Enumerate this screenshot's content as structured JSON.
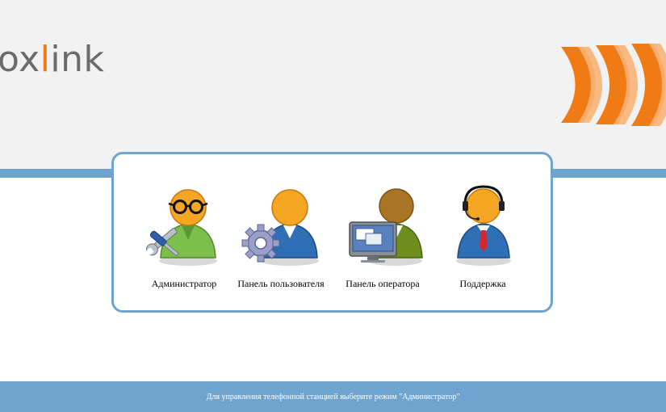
{
  "header": {
    "logo": {
      "text_start": "ox",
      "text_accent": "l",
      "text_end": "ink",
      "text_color": "#6b6b6b",
      "accent_color": "#f07a14"
    },
    "brand_icon": "orange-waves-logo-icon"
  },
  "modes": [
    {
      "label": "Администратор",
      "icon": "administrator-icon"
    },
    {
      "label": "Панель пользователя",
      "icon": "user-panel-icon"
    },
    {
      "label": "Панель оператора",
      "icon": "operator-panel-icon"
    },
    {
      "label": "Поддержка",
      "icon": "support-icon"
    }
  ],
  "footer": {
    "text": "Для управления телефонной станцией выберите режим \"Администратор\""
  },
  "colors": {
    "header_bg": "#f2f2f2",
    "accent_blue": "#6fa4cf",
    "brand_orange": "#f07a14"
  }
}
